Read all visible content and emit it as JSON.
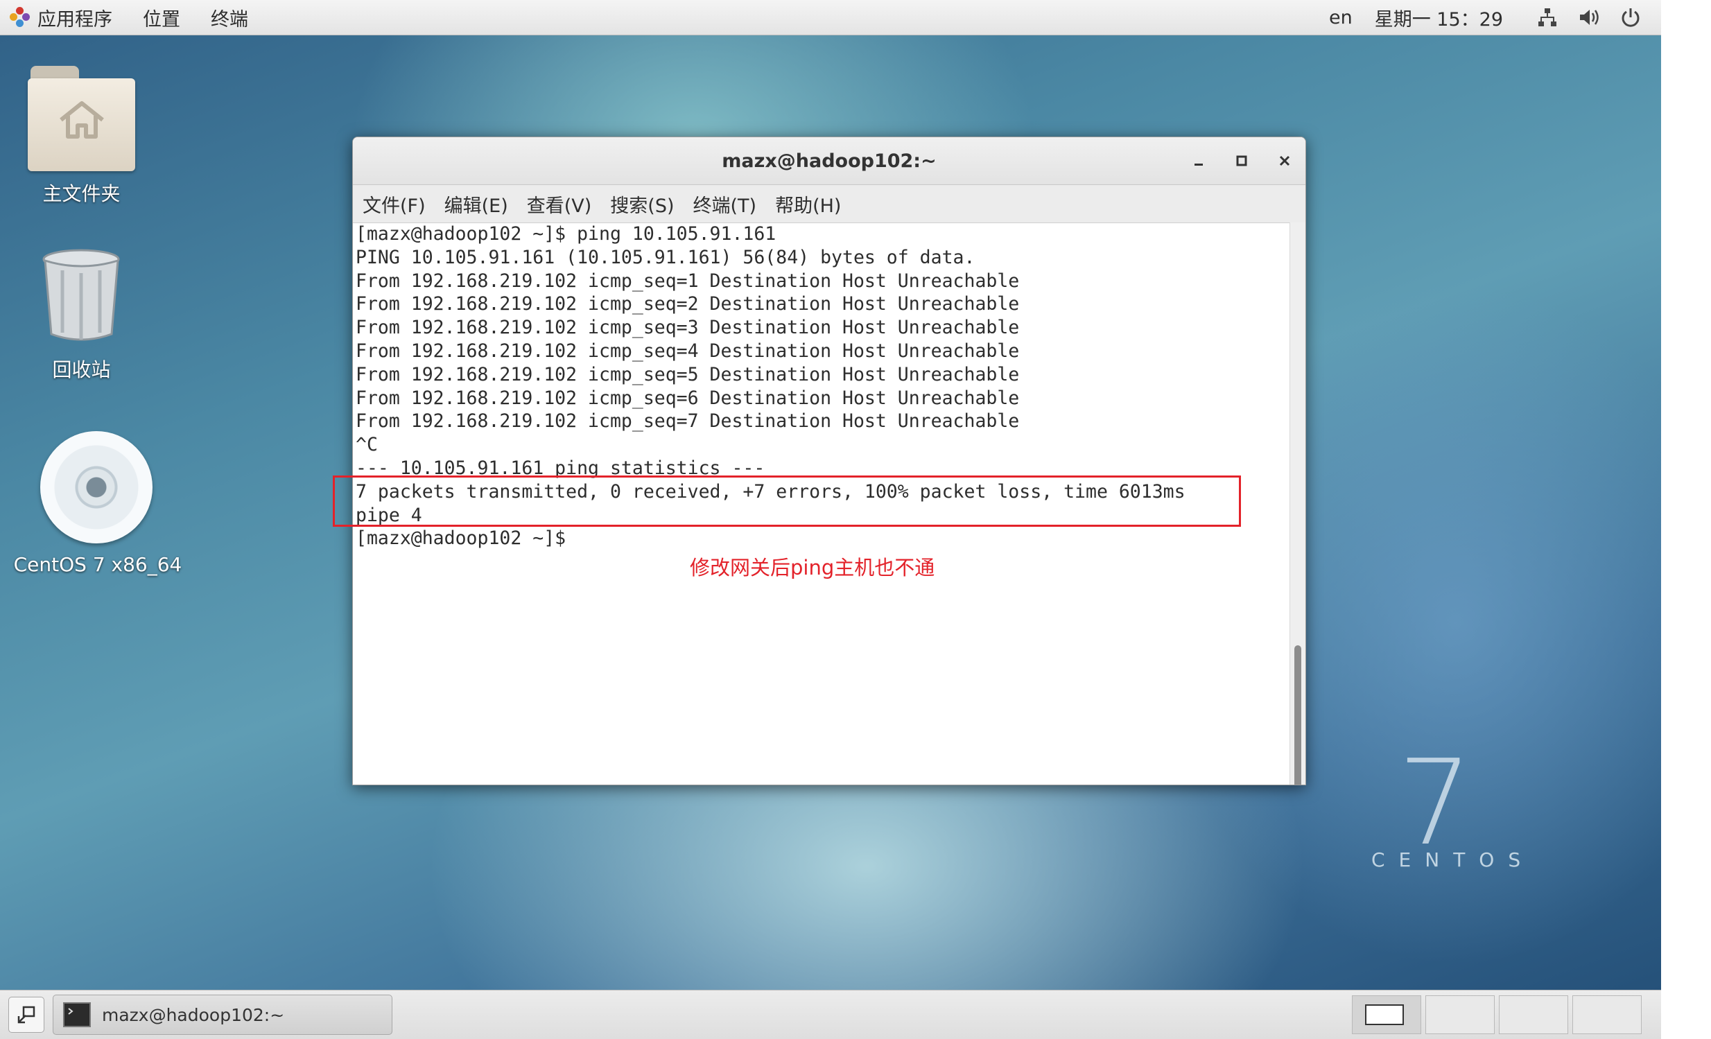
{
  "topbar": {
    "applications": "应用程序",
    "places": "位置",
    "terminal": "终端",
    "lang": "en",
    "clock": "星期一 15：29",
    "icons": [
      "network-icon",
      "volume-icon",
      "power-icon"
    ]
  },
  "desktop": {
    "home_label": "主文件夹",
    "trash_label": "回收站",
    "disc_label": "CentOS 7 x86_64",
    "wallpaper_number": "7",
    "wallpaper_text": "CENTOS"
  },
  "window": {
    "title": "mazx@hadoop102:~",
    "menu": [
      "文件(F)",
      "编辑(E)",
      "查看(V)",
      "搜索(S)",
      "终端(T)",
      "帮助(H)"
    ],
    "lines": [
      "[mazx@hadoop102 ~]$ ping 10.105.91.161",
      "PING 10.105.91.161 (10.105.91.161) 56(84) bytes of data.",
      "From 192.168.219.102 icmp_seq=1 Destination Host Unreachable",
      "From 192.168.219.102 icmp_seq=2 Destination Host Unreachable",
      "From 192.168.219.102 icmp_seq=3 Destination Host Unreachable",
      "From 192.168.219.102 icmp_seq=4 Destination Host Unreachable",
      "From 192.168.219.102 icmp_seq=5 Destination Host Unreachable",
      "From 192.168.219.102 icmp_seq=6 Destination Host Unreachable",
      "From 192.168.219.102 icmp_seq=7 Destination Host Unreachable",
      "^C",
      "--- 10.105.91.161 ping statistics ---",
      "7 packets transmitted, 0 received, +7 errors, 100% packet loss, time 6013ms",
      "pipe 4",
      "[mazx@hadoop102 ~]$ "
    ]
  },
  "annotation": "修改网关后ping主机也不通",
  "taskbar": {
    "task_label": "mazx@hadoop102:~"
  },
  "colors": {
    "annotation": "#e3222a"
  }
}
